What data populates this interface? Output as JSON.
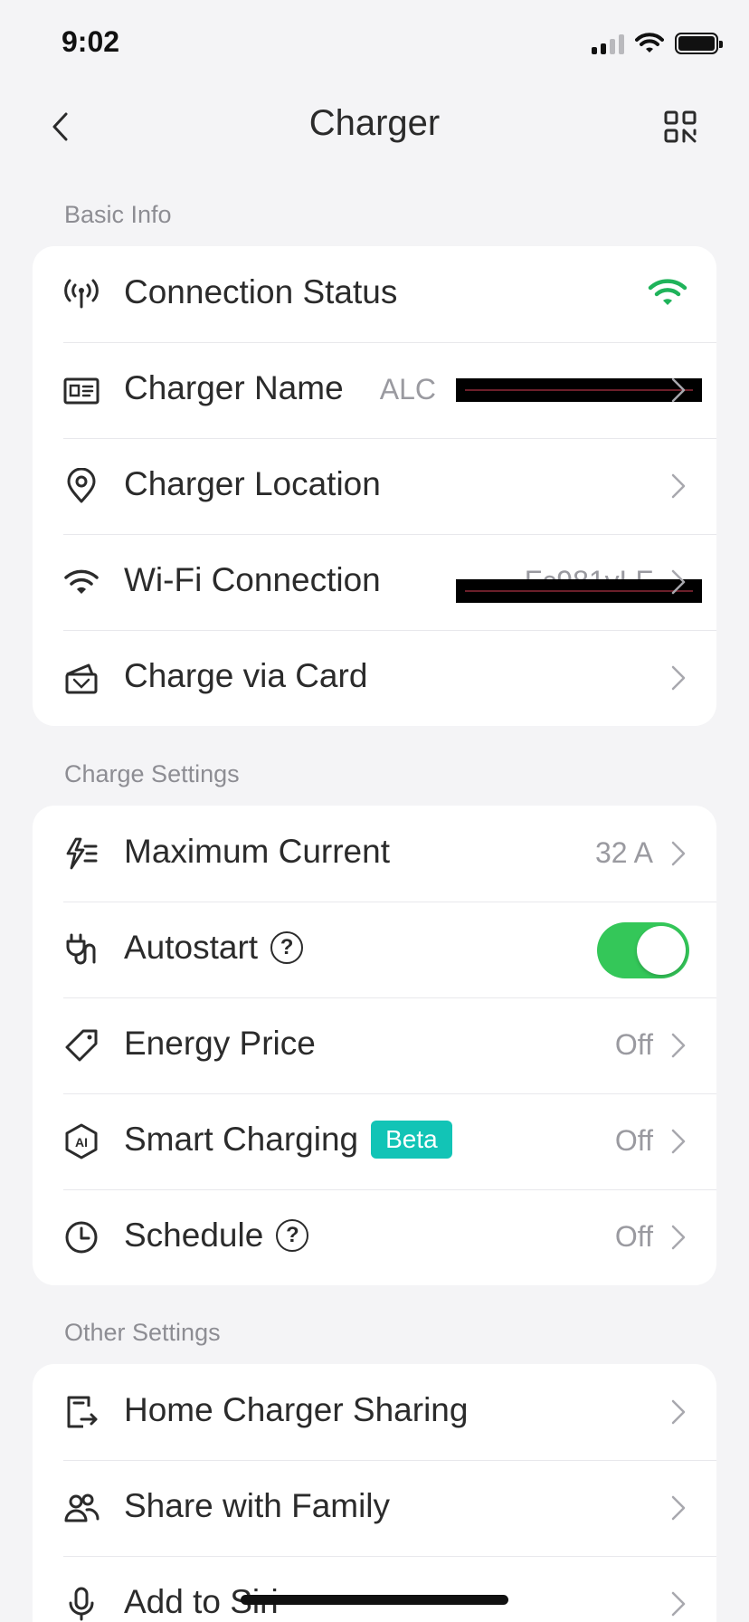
{
  "status_bar": {
    "time": "9:02"
  },
  "nav": {
    "title": "Charger",
    "back_icon": "chevron-left-icon",
    "scan_icon": "qr-scan-icon"
  },
  "sections": {
    "basic_info": {
      "title": "Basic Info",
      "rows": {
        "connection_status": {
          "label": "Connection Status"
        },
        "charger_name": {
          "label": "Charger Name",
          "value": "ALC"
        },
        "charger_location": {
          "label": "Charger Location"
        },
        "wifi_connection": {
          "label": "Wi-Fi Connection",
          "value": "Fc981vLF"
        },
        "charge_via_card": {
          "label": "Charge via Card"
        }
      }
    },
    "charge_settings": {
      "title": "Charge Settings",
      "rows": {
        "maximum_current": {
          "label": "Maximum Current",
          "value": "32 A"
        },
        "autostart": {
          "label": "Autostart",
          "help": "?",
          "enabled": true
        },
        "energy_price": {
          "label": "Energy Price",
          "value": "Off"
        },
        "smart_charging": {
          "label": "Smart Charging",
          "badge": "Beta",
          "value": "Off"
        },
        "schedule": {
          "label": "Schedule",
          "help": "?",
          "value": "Off"
        }
      }
    },
    "other_settings": {
      "title": "Other Settings",
      "rows": {
        "home_charger_sharing": {
          "label": "Home Charger Sharing"
        },
        "share_with_family": {
          "label": "Share with Family"
        },
        "add_to_siri": {
          "label": "Add to Siri"
        }
      }
    }
  },
  "colors": {
    "background": "#f4f4f6",
    "card": "#ffffff",
    "accent_green": "#34c759",
    "wifi_green": "#1fb35a",
    "beta_badge": "#12c4b6",
    "secondary_text": "#9a9aa0"
  }
}
